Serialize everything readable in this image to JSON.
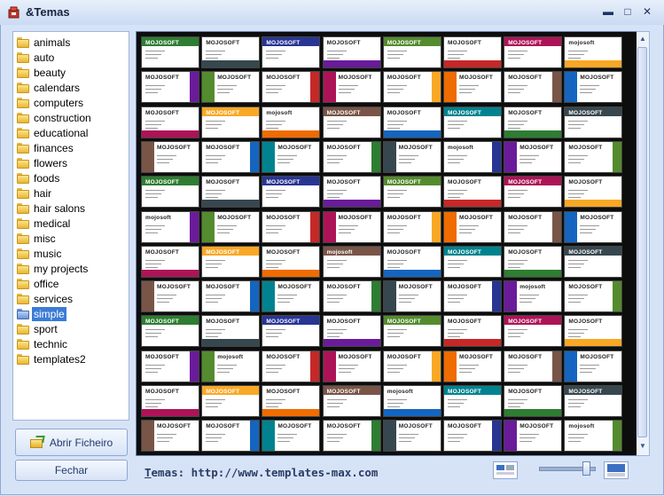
{
  "window": {
    "title": "&Temas",
    "minimize_glyph": "▬",
    "maximize_glyph": "□",
    "close_glyph": "✕"
  },
  "folders": [
    {
      "label": "animals"
    },
    {
      "label": "auto"
    },
    {
      "label": "beauty"
    },
    {
      "label": "calendars"
    },
    {
      "label": "computers"
    },
    {
      "label": "construction"
    },
    {
      "label": "educational"
    },
    {
      "label": "finances"
    },
    {
      "label": "flowers"
    },
    {
      "label": "foods"
    },
    {
      "label": "hair"
    },
    {
      "label": "hair salons"
    },
    {
      "label": "medical"
    },
    {
      "label": "misc"
    },
    {
      "label": "music"
    },
    {
      "label": "my projects"
    },
    {
      "label": "office"
    },
    {
      "label": "services"
    },
    {
      "label": "simple",
      "selected": true
    },
    {
      "label": "sport"
    },
    {
      "label": "technic"
    },
    {
      "label": "templates2"
    }
  ],
  "buttons": {
    "open_file": "Abrir Ficheiro",
    "close": "Fechar"
  },
  "footer": {
    "link_prefix": "T",
    "link_rest": "emas: http://www.templates-max.com"
  },
  "thumbnails": {
    "brand_text": "MOJOSOFT",
    "brand_text_alt": "mojosoft",
    "rows": 12,
    "cols": 8,
    "accent_colors": [
      "#2e7d32",
      "#c62828",
      "#1565c0",
      "#6a1b9a",
      "#ef6c00",
      "#37474f",
      "#ad1457",
      "#00838f",
      "#558b2f",
      "#795548",
      "#283593",
      "#f9a825"
    ]
  },
  "scrollbar": {
    "up_glyph": "▲",
    "down_glyph": "▼"
  },
  "zoom": {
    "level_fraction": 0.8
  }
}
